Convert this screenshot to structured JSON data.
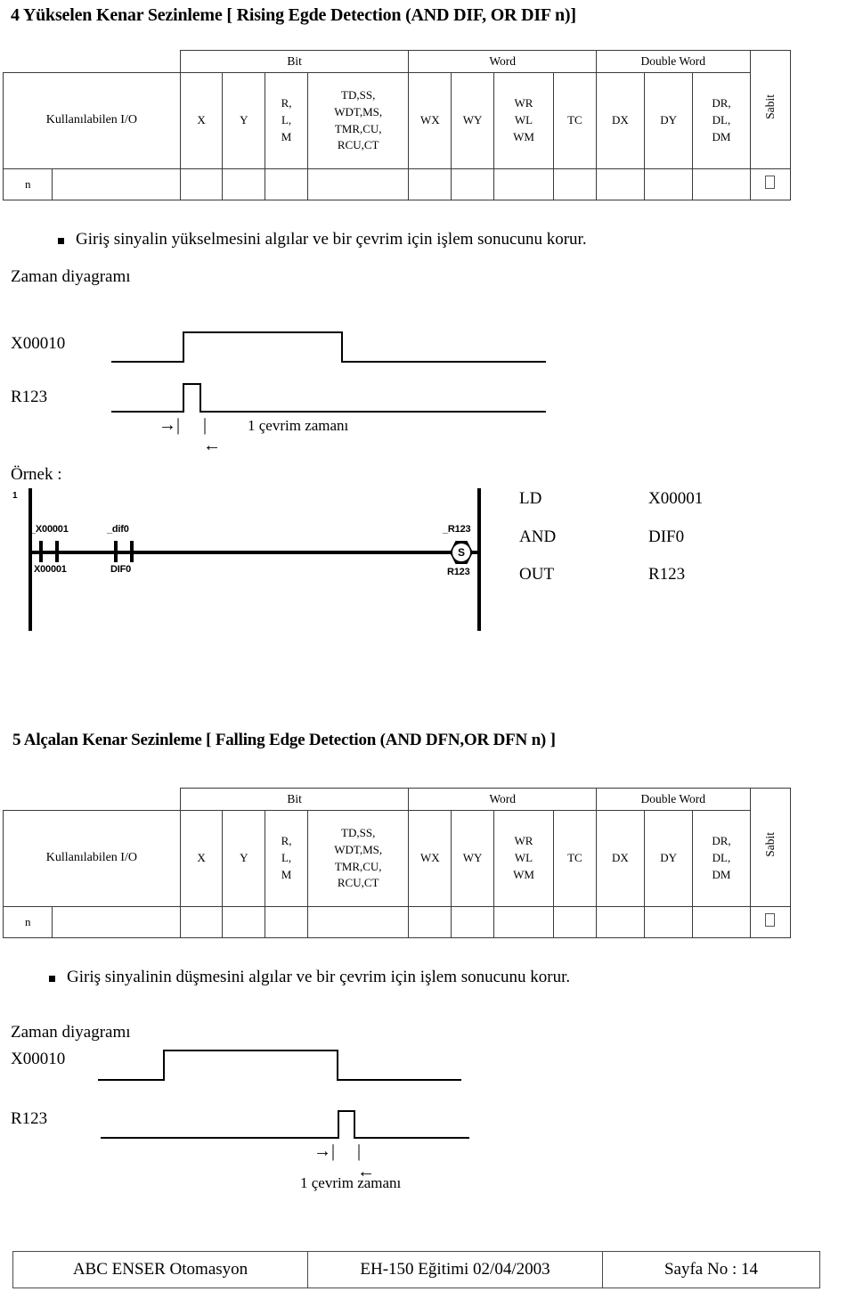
{
  "section4": {
    "heading": "4 Yükselen Kenar Sezinleme [ Rising Egde Detection (AND DIF, OR DIF n)]",
    "table": {
      "io_label": "Kullanılabilen I/O",
      "groups": [
        "Bit",
        "Word",
        "Double Word"
      ],
      "sabit_label": "Sabit",
      "columns": [
        "X",
        "Y",
        "R,|L,|M",
        "TD,SS,|WDT,MS,|TMR,CU,|RCU,CT",
        "WX",
        "WY",
        "WR|WL|WM",
        "TC",
        "DX",
        "DY",
        "DR,|DL,|DM"
      ],
      "col_x": "X",
      "col_y": "Y",
      "col_rlm": [
        "R,",
        "L,",
        "M"
      ],
      "col_td": [
        "TD,SS,",
        "WDT,MS,",
        "TMR,CU,",
        "RCU,CT"
      ],
      "col_wx": "WX",
      "col_wy": "WY",
      "col_wrwlwm": [
        "WR",
        "WL",
        "WM"
      ],
      "col_tc": "TC",
      "col_dx": "DX",
      "col_dy": "DY",
      "col_drdldm": [
        "DR,",
        "DL,",
        "DM"
      ],
      "row_label": "n",
      "sabit_mark": "checkbox-glyph"
    },
    "bullet": "Giriş sinyalin yükselmesini algılar ve bir çevrim için işlem sonucunu korur.",
    "timing_title": "Zaman diyagramı",
    "signal1": "X00010",
    "signal2": "R123",
    "cycle_label": "1 çevrim zamanı",
    "example_label": "Örnek :",
    "ladder": {
      "rung_number": "1",
      "contact1_top": "_X00001",
      "contact1_bottom": "X00001",
      "contact2_top": "_dif0",
      "contact2_bottom": "DIF0",
      "coil_top": "_R123",
      "coil_bottom": "R123",
      "coil_glyph": "S"
    },
    "instructions": [
      {
        "op": "LD",
        "operand": "X00001"
      },
      {
        "op": "AND",
        "operand": "DIF0"
      },
      {
        "op": "OUT",
        "operand": "R123"
      }
    ]
  },
  "section5": {
    "heading": "5 Alçalan Kenar Sezinleme [ Falling Edge Detection (AND DFN,OR DFN n) ]",
    "table": {
      "io_label": "Kullanılabilen I/O",
      "groups": [
        "Bit",
        "Word",
        "Double Word"
      ],
      "sabit_label": "Sabit",
      "col_x": "X",
      "col_y": "Y",
      "col_rlm": [
        "R,",
        "L,",
        "M"
      ],
      "col_td": [
        "TD,SS,",
        "WDT,MS,",
        "TMR,CU,",
        "RCU,CT"
      ],
      "col_wx": "WX",
      "col_wy": "WY",
      "col_wrwlwm": [
        "WR",
        "WL",
        "WM"
      ],
      "col_tc": "TC",
      "col_dx": "DX",
      "col_dy": "DY",
      "col_drdldm": [
        "DR,",
        "DL,",
        "DM"
      ],
      "row_label": "n",
      "sabit_mark": "checkbox-glyph"
    },
    "bullet": "Giriş sinyalinin düşmesini algılar ve bir çevrim için işlem sonucunu korur.",
    "timing_title": "Zaman diyagramı",
    "signal1": "X00010",
    "signal2": "R123",
    "cycle_label": "1 çevrim zamanı"
  },
  "footer": {
    "company": "ABC ENSER Otomasyon",
    "course": "EH-150 Eğitimi  02/04/2003",
    "page": "Sayfa No : 14"
  }
}
